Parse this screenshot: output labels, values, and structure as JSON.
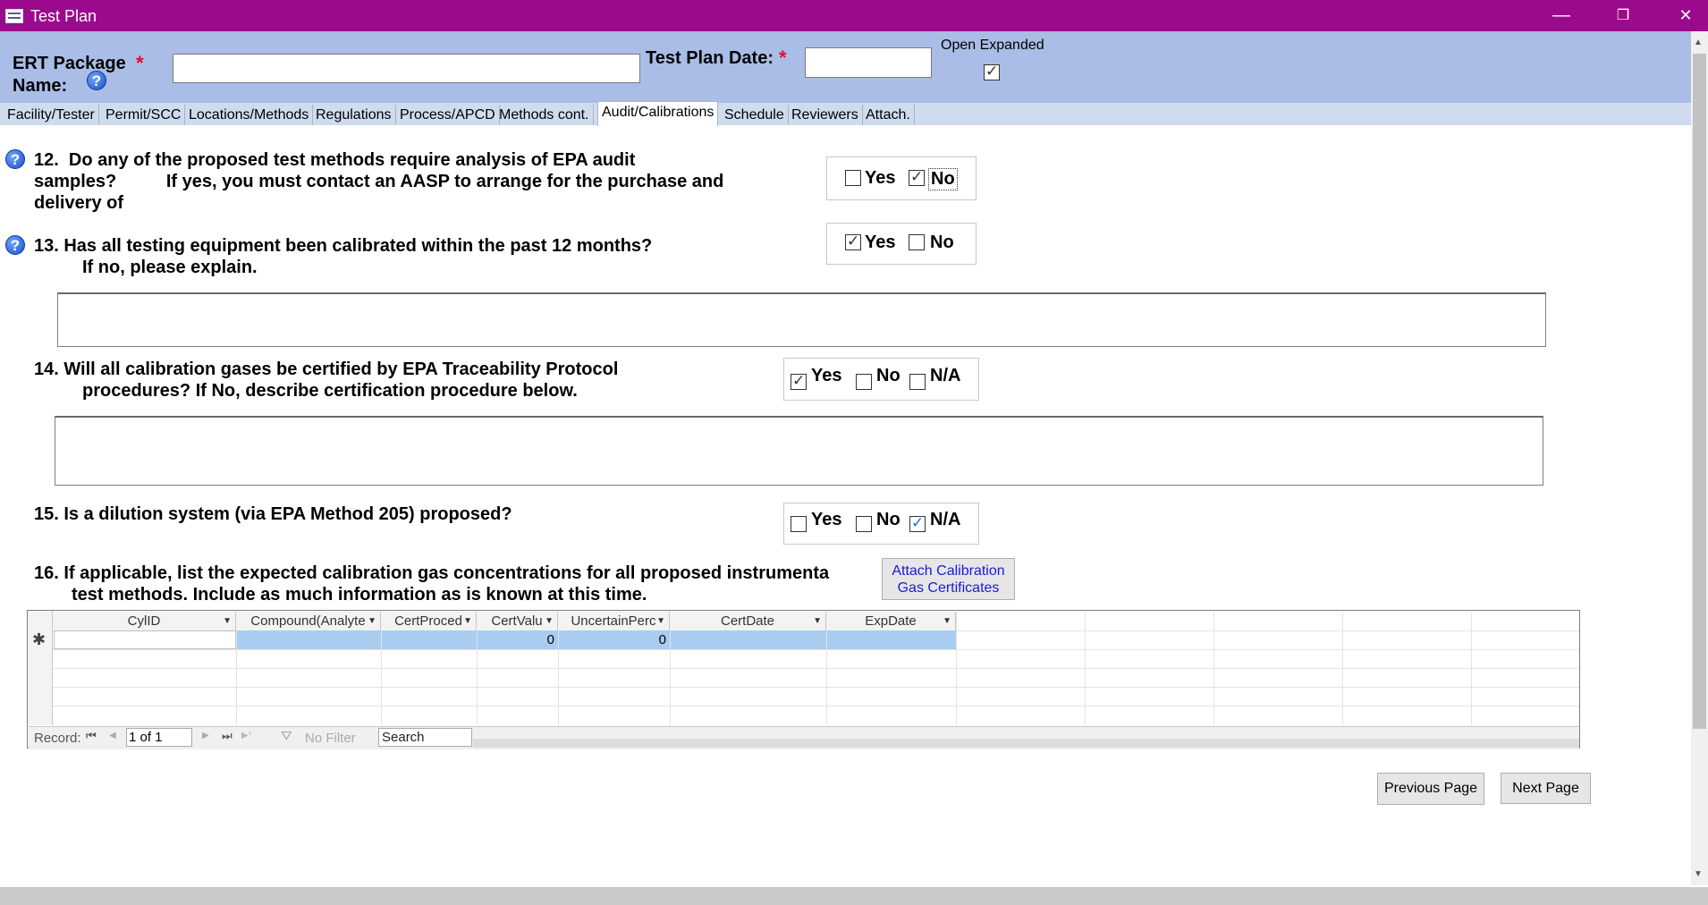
{
  "window": {
    "title": "Test Plan",
    "minimize": "—",
    "restore": "❐",
    "close": "✕",
    "title_bar_color": "#9b0a8c"
  },
  "header": {
    "package_label_line1": "ERT Package",
    "package_label_line2": "Name:",
    "required_mark": "*",
    "package_name_value": "",
    "test_plan_date_label": "Test Plan Date:",
    "test_plan_date_value": "",
    "open_expanded_label": "Open Expanded",
    "open_expanded_checked": true,
    "help": "?"
  },
  "tabs": [
    {
      "label": "Facility/Tester",
      "active": false
    },
    {
      "label": "Permit/SCC",
      "active": false
    },
    {
      "label": "Locations/Methods",
      "active": false
    },
    {
      "label": "Regulations",
      "active": false
    },
    {
      "label": "Process/APCD",
      "active": false
    },
    {
      "label": "Methods cont.",
      "active": false
    },
    {
      "label": "Audit/Calibrations",
      "active": true
    },
    {
      "label": "Schedule",
      "active": false
    },
    {
      "label": "Reviewers",
      "active": false
    },
    {
      "label": "Attach.",
      "active": false
    }
  ],
  "questions": {
    "q12": {
      "line1": "12.  Do any of the proposed test methods require analysis of EPA audit",
      "line2": "samples?          If yes, you must contact an AASP to arrange for the purchase and",
      "line3": "delivery of",
      "yes": "Yes",
      "no": "No",
      "yes_checked": false,
      "no_checked": true
    },
    "q13": {
      "line1": "13.  Has all testing equipment been calibrated within the past 12 months?",
      "line2": "If no, please explain.",
      "yes": "Yes",
      "no": "No",
      "yes_checked": true,
      "no_checked": false,
      "explanation": ""
    },
    "q14": {
      "line1": "14.  Will all calibration gases be certified by EPA Traceability Protocol",
      "line2": "procedures?  If No, describe certification procedure below.",
      "yes": "Yes",
      "no": "No",
      "na": "N/A",
      "yes_checked": true,
      "no_checked": false,
      "na_checked": false,
      "description": ""
    },
    "q15": {
      "line1": "15.  Is a dilution system (via EPA Method 205) proposed?",
      "yes": "Yes",
      "no": "No",
      "na": "N/A",
      "yes_checked": false,
      "no_checked": false,
      "na_checked": true
    },
    "q16": {
      "line1": "16.  If applicable, list the expected calibration gas concentrations for all proposed instrumenta",
      "line2": "test methods.  Include as much information as is known at this time.",
      "attach_button_line1": "Attach Calibration",
      "attach_button_line2": "Gas Certificates"
    }
  },
  "grid": {
    "columns": [
      "CylID",
      "Compound(Analyte",
      "CertProced",
      "CertValu",
      "UncertainPerc",
      "CertDate",
      "ExpDate"
    ],
    "new_row_marker": "✱",
    "new_row_values": [
      "",
      "",
      "",
      "0",
      "0",
      "",
      ""
    ],
    "selection_color": "#a9cdf0"
  },
  "navigation": {
    "record_label": "Record:",
    "first": "⏮",
    "prev": "◀",
    "position": "1 of 1",
    "next": "▶",
    "last": "⏭",
    "new": "▶*",
    "filter_icon": "⛛",
    "filter_label": "No Filter",
    "search_placeholder": "Search"
  },
  "footer": {
    "previous_page": "Previous Page",
    "next_page": "Next Page"
  },
  "scrollbar": {
    "up": "▲",
    "down": "▼"
  }
}
